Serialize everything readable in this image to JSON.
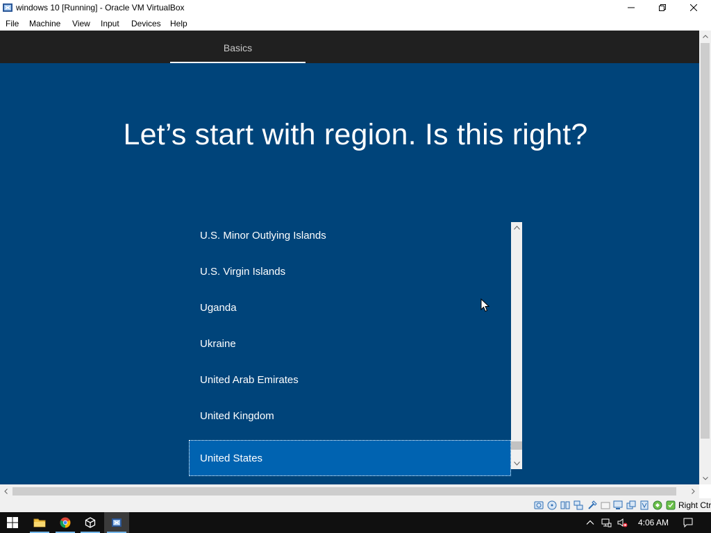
{
  "window": {
    "title": "windows 10 [Running] - Oracle VM VirtualBox"
  },
  "menu": {
    "items": [
      "File",
      "Machine",
      "View",
      "Input",
      "Devices",
      "Help"
    ]
  },
  "oobe": {
    "tab_label": "Basics",
    "headline": "Let’s start with region. Is this right?",
    "regions": [
      "U.S. Minor Outlying Islands",
      "U.S. Virgin Islands",
      "Uganda",
      "Ukraine",
      "United Arab Emirates",
      "United Kingdom",
      "United States"
    ],
    "selected_region": "United States",
    "list_scroll_fraction": 0.96
  },
  "statusbar": {
    "host_key": "Right Ctrl",
    "icons": [
      "hard-disk-icon",
      "optical-drive-icon",
      "audio-icon",
      "network-icon",
      "usb-icon",
      "shared-folders-icon",
      "display-icon",
      "video-capture-icon",
      "recording-icon",
      "cpu-icon",
      "mouse-integration-icon"
    ]
  },
  "taskbar": {
    "apps": [
      "start-icon",
      "file-explorer-icon",
      "chrome-icon",
      "virtualbox-icon",
      "virtualbox-vm-icon"
    ],
    "active_app": "virtualbox-vm-icon",
    "clock": "4:06 AM"
  },
  "colors": {
    "oobe_background": "#00447a",
    "header_background": "#202020",
    "selected_item": "#0063b1",
    "taskbar": "#101010"
  }
}
